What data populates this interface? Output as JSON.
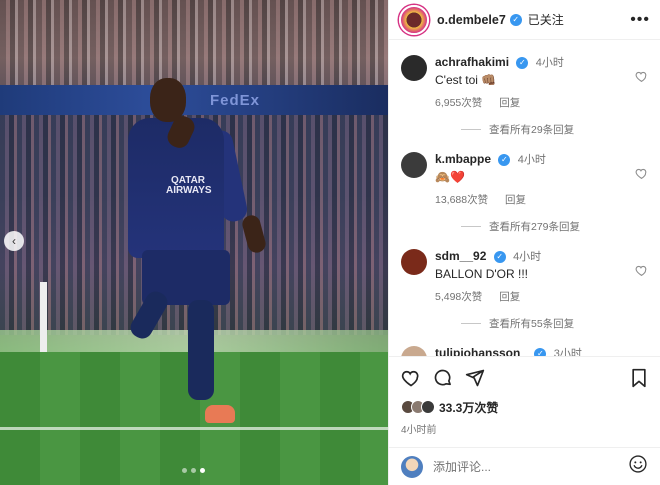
{
  "post": {
    "banner_text": "FedEx",
    "jersey_sponsor": "QATAR AIRWAYS",
    "carousel_prev": "‹",
    "carousel_dots": 3,
    "carousel_active_index": 2
  },
  "header": {
    "username": "o.dembele7",
    "verified": "✓",
    "follow_status": "已关注",
    "more": "•••"
  },
  "comments": [
    {
      "user": "achrafhakimi",
      "time": "4小时",
      "text": "C'est toi 👊🏽",
      "likes": "6,955次赞",
      "reply": "回复",
      "view_replies": "查看所有29条回复",
      "avatar_color": "#2a2a2a"
    },
    {
      "user": "k.mbappe",
      "time": "4小时",
      "text": "🙈❤️",
      "likes": "13,688次赞",
      "reply": "回复",
      "view_replies": "查看所有279条回复",
      "avatar_color": "#3b3b3b"
    },
    {
      "user": "sdm__92",
      "time": "4小时",
      "text": "BALLON D'OR !!!",
      "likes": "5,498次赞",
      "reply": "回复",
      "view_replies": "查看所有55条回复",
      "avatar_color": "#7a2a1a"
    },
    {
      "user": "tulipjohansson_",
      "time": "3小时",
      "text": "😂😂😂",
      "likes": "",
      "reply": "",
      "view_replies": "",
      "avatar_color": "#c9a98f"
    }
  ],
  "actions": {
    "like_icon": "heart-outline-icon",
    "comment_icon": "comment-bubble-icon",
    "share_icon": "paper-plane-icon",
    "save_icon": "bookmark-icon",
    "likes_count": "33.3万次赞",
    "post_time": "4小时前"
  },
  "composer": {
    "placeholder": "添加评论...",
    "emoji_icon": "emoji-smile-icon"
  },
  "colors": {
    "verified_blue": "#3897f0",
    "meta_gray": "#737373"
  }
}
